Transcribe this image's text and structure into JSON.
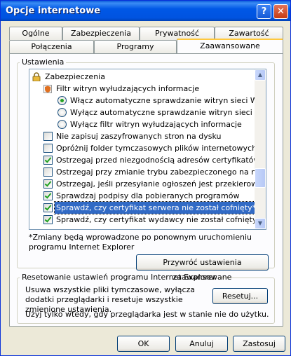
{
  "window": {
    "title": "Opcje internetowe"
  },
  "tabs": {
    "row_top": [
      "Ogólne",
      "Zabezpieczenia",
      "Prywatność",
      "Zawartość"
    ],
    "row_bottom": [
      "Połączenia",
      "Programy",
      "Zaawansowane"
    ]
  },
  "settings": {
    "group_label": "Ustawienia",
    "items": [
      {
        "kind": "category",
        "label": "Zabezpieczenia"
      },
      {
        "kind": "subcategory",
        "label": "Filtr witryn wyłudzających informacje"
      },
      {
        "kind": "radio",
        "checked": true,
        "label": "Włącz automatyczne sprawdzanie witryn sieci Web"
      },
      {
        "kind": "radio",
        "checked": false,
        "label": "Wyłącz automatyczne sprawdzanie witryn sieci Web"
      },
      {
        "kind": "radio",
        "checked": false,
        "label": "Wyłącz filtr witryn wyłudzających informacje"
      },
      {
        "kind": "checkbox",
        "checked": false,
        "label": "Nie zapisuj zaszyfrowanych stron na dysku"
      },
      {
        "kind": "checkbox",
        "checked": false,
        "label": "Opróżnij folder tymczasowych plików internetowych podcz"
      },
      {
        "kind": "checkbox",
        "checked": true,
        "label": "Ostrzegaj przed niezgodnością adresów certyfikatów*"
      },
      {
        "kind": "checkbox",
        "checked": false,
        "label": "Ostrzegaj przy zmianie trybu zabezpieczonego na niezabe"
      },
      {
        "kind": "checkbox",
        "checked": true,
        "label": "Ostrzegaj, jeśli przesyłanie ogłoszeń jest przekierowywan"
      },
      {
        "kind": "checkbox",
        "checked": true,
        "label": "Sprawdzaj podpisy dla pobieranych programów"
      },
      {
        "kind": "checkbox",
        "checked": true,
        "selected": true,
        "label": "Sprawdź, czy certyfikat serwera nie został cofnięty*"
      },
      {
        "kind": "checkbox",
        "checked": true,
        "label": "Sprawdź, czy certyfikat wydawcy nie został cofnięty"
      }
    ],
    "note": "*Zmiany będą wprowadzone po ponownym uruchomieniu programu Internet Explorer",
    "restore_button": "Przywróć ustawienia zaawansowane"
  },
  "reset": {
    "group_label": "Resetowanie ustawień programu Internet Explorer",
    "description": "Usuwa wszystkie pliki tymczasowe, wyłącza dodatki przeglądarki i resetuje wszystkie zmienione ustawienia.",
    "button": "Resetuj...",
    "warning": "Użyj tylko wtedy, gdy przeglądarka jest w stanie nie do użytku."
  },
  "footer": {
    "ok": "OK",
    "cancel": "Anuluj",
    "apply": "Zastosuj"
  },
  "scroll": {
    "position_fraction": 0.72
  }
}
